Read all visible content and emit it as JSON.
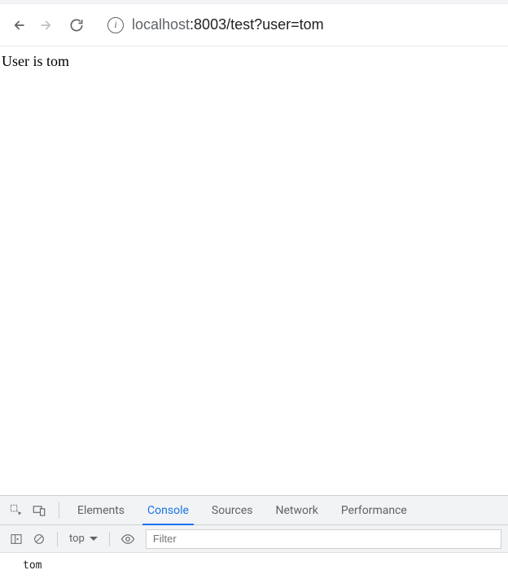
{
  "url": {
    "host_prefix": "localhost",
    "host_port": ":8003",
    "path": "/test",
    "query": "?user=tom"
  },
  "page": {
    "body_text": "User is tom"
  },
  "devtools": {
    "tabs": {
      "elements": "Elements",
      "console": "Console",
      "sources": "Sources",
      "network": "Network",
      "performance": "Performance"
    },
    "console": {
      "context": "top",
      "filter_placeholder": "Filter",
      "output": "tom"
    }
  }
}
